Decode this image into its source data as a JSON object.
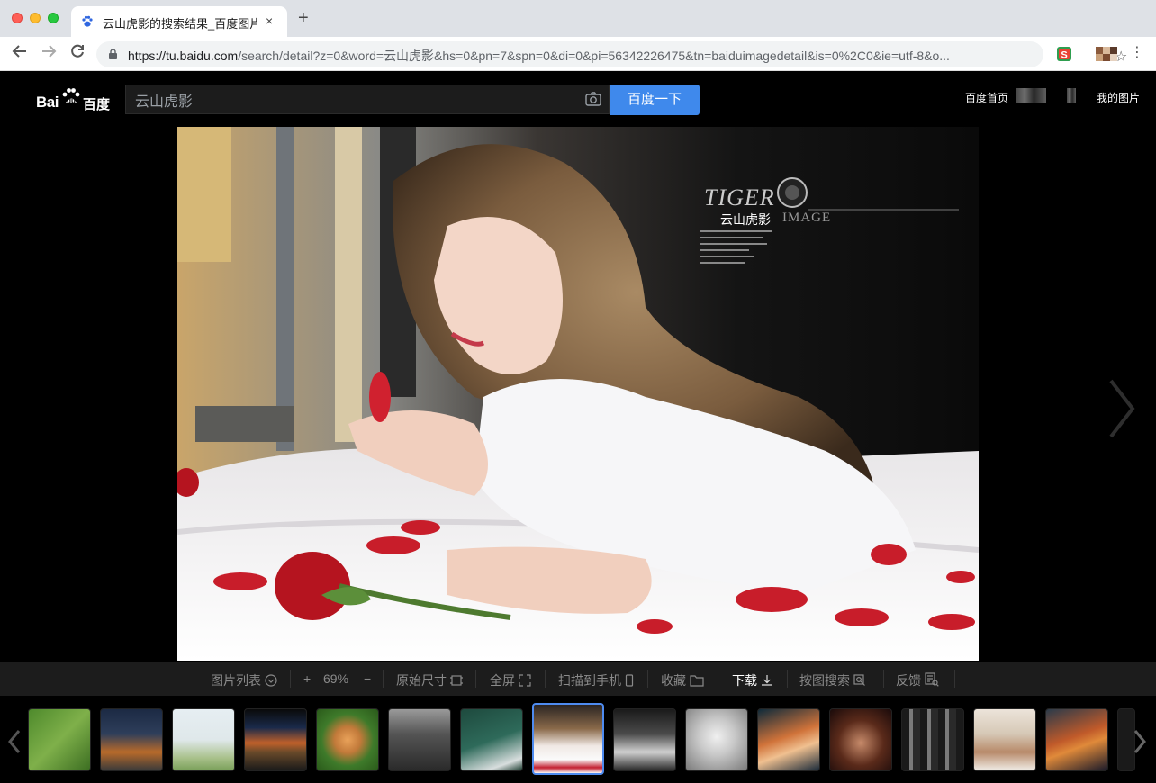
{
  "browser": {
    "tab_title": "云山虎影的搜索结果_百度图片搜",
    "tab_close": "×",
    "new_tab": "+",
    "url_host": "https://tu.baidu.com",
    "url_path": "/search/detail?z=0&word=云山虎影&hs=0&pn=7&spn=0&di=0&pi=56342226475&tn=baiduimagedetail&is=0%2C0&ie=utf-8&o..."
  },
  "header": {
    "logo_text": "Bai",
    "logo_cn": "百度",
    "search_value": "云山虎影",
    "search_button": "百度一下",
    "link_home": "百度首页",
    "link_my_images": "我的图片"
  },
  "photo": {
    "watermark_tiger": "TIGER",
    "watermark_name": "云山虎影",
    "watermark_image": "IMAGE"
  },
  "viewer_bar": {
    "list": "图片列表",
    "zoom_in": "+",
    "zoom_level": "69%",
    "zoom_out": "−",
    "original_size": "原始尺寸",
    "fullscreen": "全屏",
    "scan_to_phone": "扫描到手机",
    "favorite": "收藏",
    "download": "下载",
    "search_by_image": "按图搜索",
    "feedback": "反馈"
  },
  "thumbnails": {
    "count": 16,
    "active_index": 7
  }
}
